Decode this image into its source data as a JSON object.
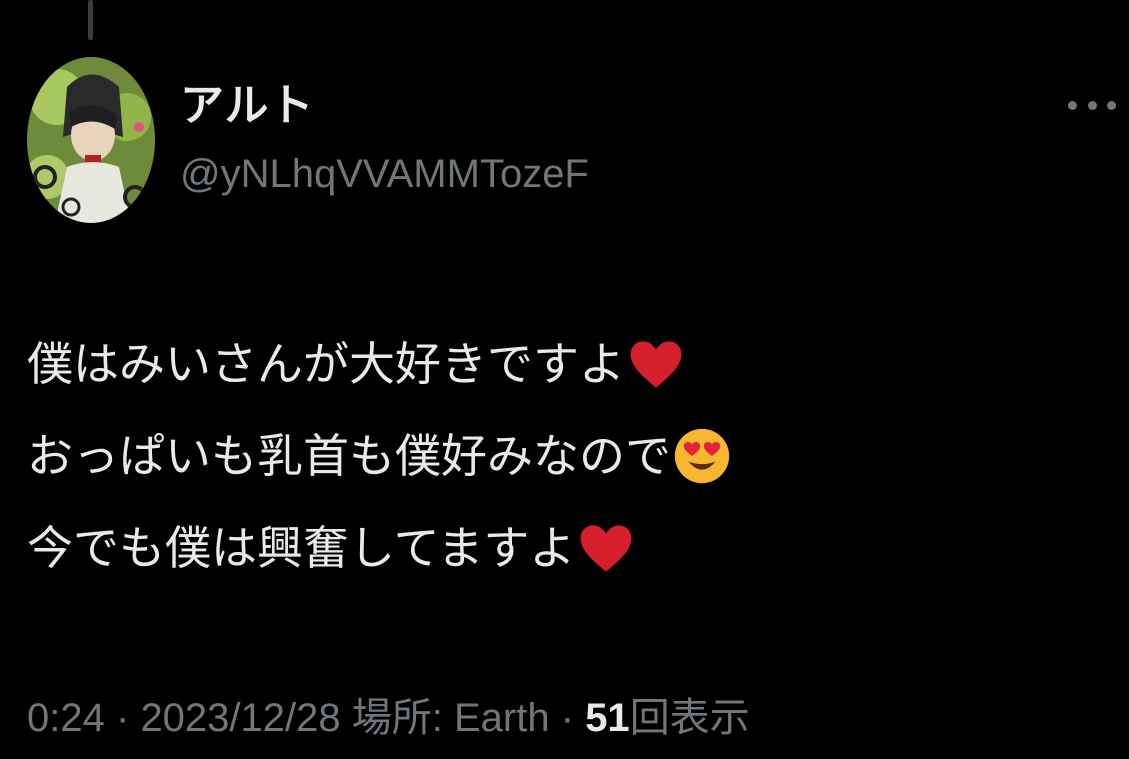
{
  "author": {
    "display_name": "アルト",
    "handle": "@yNLhqVVAMMTozeF",
    "avatar_icon": "avatar-image"
  },
  "menu": {
    "icon": "more-horizontal-icon"
  },
  "tweet": {
    "lines": [
      {
        "text": "僕はみいさんが大好きですよ",
        "emoji": "red-heart"
      },
      {
        "text": "おっぱいも乳首も僕好みなので",
        "emoji": "heart-eyes-face"
      },
      {
        "text": "今でも僕は興奮してますよ",
        "emoji": "red-heart"
      }
    ]
  },
  "meta": {
    "time": "0:24",
    "separator": "·",
    "date": "2023/12/28",
    "location_label": "場所: Earth",
    "view_count": "51",
    "view_suffix": "回表示"
  },
  "colors": {
    "background": "#000000",
    "primary_text": "#e7e9ea",
    "secondary_text": "#71767b",
    "heart": "#d61f2c",
    "emoji_face": "#f7b731"
  }
}
